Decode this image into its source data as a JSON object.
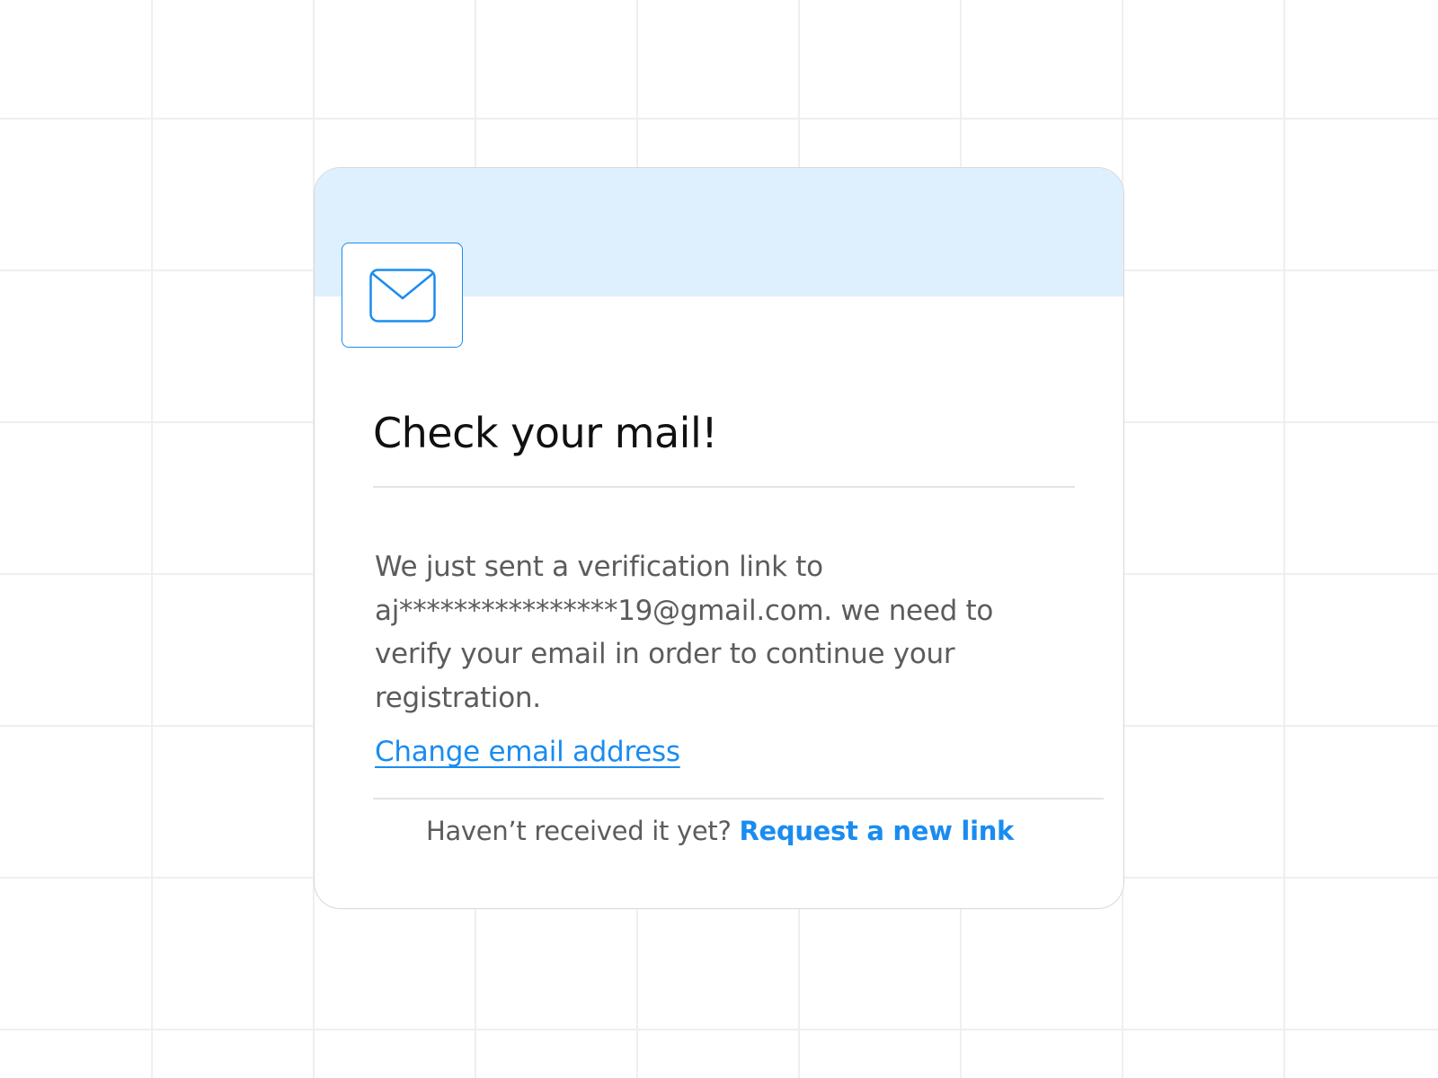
{
  "card": {
    "title": "Check your mail!",
    "message": "We just sent a verification link to aj****************19@gmail.com. we need to verify your email in order to continue your registration.",
    "change_email_link": "Change email address",
    "footer_prompt": "Haven’t received it yet?",
    "request_link": "Request a new link",
    "icon": "mail-icon"
  },
  "colors": {
    "accent": "#1a8cf0",
    "banner": "#def0fd",
    "title": "#111111",
    "body_text": "#5c5c5c",
    "divider": "#e3e3e3",
    "grid_line": "#efefef"
  }
}
